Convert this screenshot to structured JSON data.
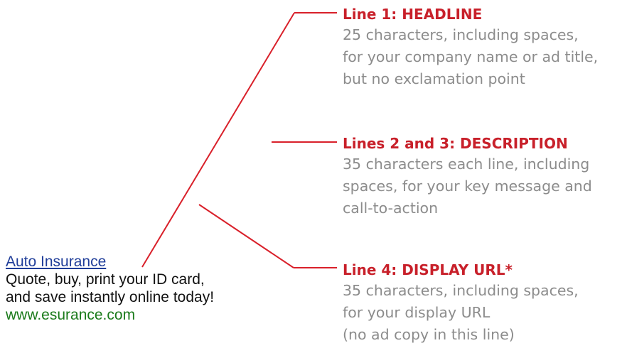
{
  "ad": {
    "headline": "Auto Insurance",
    "description_line_1": "Quote, buy, print your ID card,",
    "description_line_2": "and save instantly online today!",
    "display_url": "www.esurance.com"
  },
  "notes": [
    {
      "title": "Line 1: HEADLINE",
      "body": [
        "25 characters, including spaces,",
        "for your company name or ad title,",
        "but no exclamation point"
      ]
    },
    {
      "title": "Lines 2 and 3: DESCRIPTION",
      "body": [
        "35 characters each line, including",
        "spaces, for your key message and",
        "call-to-action"
      ]
    },
    {
      "title": "Line 4: DISPLAY URL*",
      "body": [
        "35 characters, including spaces,",
        "for your display URL",
        "(no ad copy in this line)"
      ]
    }
  ],
  "colors": {
    "headline_link": "#1f3d99",
    "display_url": "#1a7a1a",
    "accent_red": "#c8202a",
    "note_text": "#8c8c8c"
  }
}
